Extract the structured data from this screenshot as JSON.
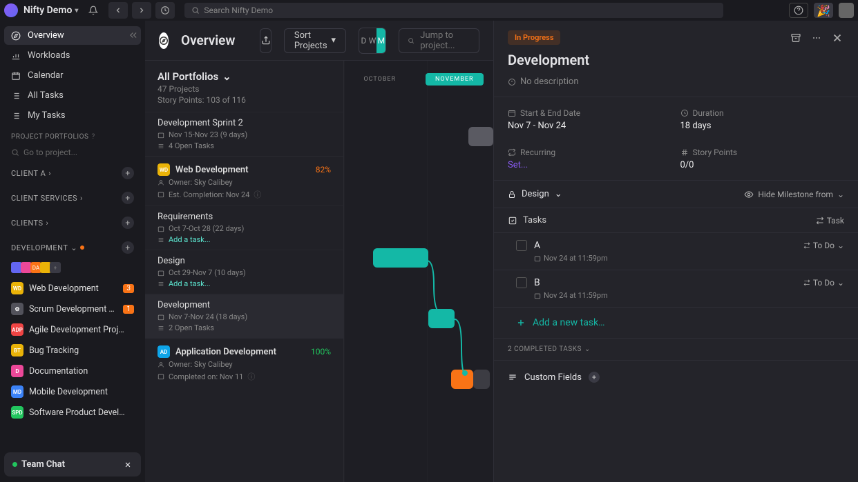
{
  "topbar": {
    "workspace_name": "Nifty Demo",
    "search_placeholder": "Search Nifty Demo"
  },
  "sidebar": {
    "nav": [
      {
        "label": "Overview",
        "active": true
      },
      {
        "label": "Workloads"
      },
      {
        "label": "Calendar"
      },
      {
        "label": "All Tasks"
      },
      {
        "label": "My Tasks"
      }
    ],
    "portfolio_header": "PROJECT PORTFOLIOS",
    "project_search_placeholder": "Go to project...",
    "folders": [
      {
        "label": "CLIENT A"
      },
      {
        "label": "CLIENT SERVICES"
      },
      {
        "label": "CLIENTS"
      },
      {
        "label": "DEVELOPMENT",
        "expanded": true,
        "has_dot": true
      }
    ],
    "projects": [
      {
        "label": "Web Development",
        "badge": "WD",
        "color": "#eab308",
        "count": "3"
      },
      {
        "label": "Scrum Development E…",
        "badge": "⚙",
        "color": "#52525b",
        "count": "1"
      },
      {
        "label": "Agile Development Proj…",
        "badge": "ADP",
        "color": "#ef4444"
      },
      {
        "label": "Bug Tracking",
        "badge": "BT",
        "color": "#eab308"
      },
      {
        "label": "Documentation",
        "badge": "D",
        "color": "#ec4899"
      },
      {
        "label": "Mobile Development",
        "badge": "MD",
        "color": "#3b82f6"
      },
      {
        "label": "Software Product Devel…",
        "badge": "SPD",
        "color": "#22c55e"
      }
    ],
    "team_chat": "Team Chat"
  },
  "center": {
    "title": "Overview",
    "sort_label": "Sort Projects",
    "view_toggle": [
      "D",
      "W",
      "M"
    ],
    "jump_placeholder": "Jump to project...",
    "portfolio_title": "All Portfolios",
    "portfolio_count": "47 Projects",
    "story_points": "Story Points: 103 of 116",
    "months": [
      "OCTOBER",
      "NOVEMBER"
    ],
    "rows": [
      {
        "type": "sprint",
        "title": "Development Sprint 2",
        "dates": "Nov 15-Nov 23 (9 days)",
        "open": "4 Open Tasks"
      },
      {
        "type": "project",
        "title": "Web Development",
        "badge": "WD",
        "badge_color": "#eab308",
        "pct": "82%",
        "owner": "Owner: Sky Calibey",
        "completion": "Est. Completion: Nov 24"
      },
      {
        "type": "milestone",
        "title": "Requirements",
        "dates": "Oct 7-Oct 28 (22 days)",
        "add": "Add a task..."
      },
      {
        "type": "milestone",
        "title": "Design",
        "dates": "Oct 29-Nov 7 (10 days)",
        "add": "Add a task..."
      },
      {
        "type": "milestone",
        "title": "Development",
        "dates": "Nov 7-Nov 24 (18 days)",
        "open": "2 Open Tasks"
      },
      {
        "type": "project",
        "title": "Application Development",
        "badge": "AD",
        "badge_color": "#0ea5e9",
        "pct": "100%",
        "pct_green": true,
        "owner": "Owner: Sky Calibey",
        "completion": "Completed on: Nov 11"
      }
    ]
  },
  "rightpanel": {
    "status": "In Progress",
    "title": "Development",
    "no_description": "No description",
    "fields": {
      "start_end_label": "Start & End Date",
      "start_end_val": "Nov 7 - Nov 24",
      "duration_label": "Duration",
      "duration_val": "18 days",
      "recurring_label": "Recurring",
      "recurring_val": "Set...",
      "story_points_label": "Story Points",
      "story_points_val": "0/0"
    },
    "visibility_label": "Design",
    "hide_milestone": "Hide Milestone from",
    "tasks_label": "Tasks",
    "task_button": "Task",
    "tasks": [
      {
        "name": "A",
        "due": "Nov 24 at 11:59pm",
        "status": "To Do"
      },
      {
        "name": "B",
        "due": "Nov 24 at 11:59pm",
        "status": "To Do"
      }
    ],
    "add_task": "Add a new task…",
    "completed_label": "2 COMPLETED TASKS",
    "custom_fields": "Custom Fields"
  }
}
